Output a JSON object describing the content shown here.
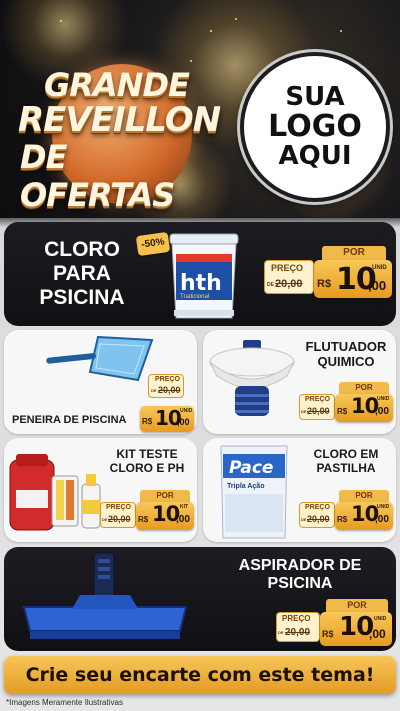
{
  "header": {
    "headline": [
      "GRANDE",
      "REVEILLON",
      "DE OFERTAS"
    ],
    "logo_text": [
      "SUA",
      "LOGO",
      "AQUI"
    ]
  },
  "products": [
    {
      "name": "CLORO\nPARA\nPSICINA",
      "name_lines": [
        "CLORO",
        "PARA",
        "PSICINA"
      ],
      "discount": "-50%",
      "preco_label": "PREÇO",
      "de": "DE",
      "old_price": "20,00",
      "por_label": "POR",
      "currency": "R$",
      "price_int": "10",
      "price_cents": ",00",
      "unit": "UNID"
    },
    {
      "name_lines": [
        "PENEIRA DE PISCINA"
      ],
      "preco_label": "PREÇO",
      "de": "DE",
      "old_price": "20,00",
      "por_label": "POR",
      "currency": "R$",
      "price_int": "10",
      "price_cents": ",00",
      "unit": "UNID"
    },
    {
      "name_lines": [
        "FLUTUADOR",
        "QUIMICO"
      ],
      "preco_label": "PREÇO",
      "de": "DE",
      "old_price": "20,00",
      "por_label": "POR",
      "currency": "R$",
      "price_int": "10",
      "price_cents": ",00",
      "unit": "UNID"
    },
    {
      "name_lines": [
        "KIT TESTE",
        "CLORO E PH"
      ],
      "preco_label": "PREÇO",
      "de": "DE",
      "old_price": "20,00",
      "por_label": "POR",
      "currency": "R$",
      "price_int": "10",
      "price_cents": ",00",
      "unit": "KIT"
    },
    {
      "name_lines": [
        "CLORO EM",
        "PASTILHA"
      ],
      "preco_label": "PREÇO",
      "de": "DE",
      "old_price": "20,00",
      "por_label": "POR",
      "currency": "R$",
      "price_int": "10",
      "price_cents": ",00",
      "unit": "UNID"
    },
    {
      "name_lines": [
        "ASPIRADOR DE",
        "PSICINA"
      ],
      "preco_label": "PREÇO",
      "de": "DE",
      "old_price": "20,00",
      "por_label": "POR",
      "currency": "R$",
      "price_int": "10",
      "price_cents": ",00",
      "unit": "UNID"
    }
  ],
  "packaging": {
    "hth_brand": "hth",
    "hth_sub": "Tradicional",
    "pace_brand": "Pace",
    "pace_sub": "Tripla Ação"
  },
  "cta": "Crie seu encarte com este tema!",
  "disclaimer": "*Imagens Meramente Ilustrativas",
  "colors": {
    "gold": "#f0b94a",
    "dark_panel": "#15151a",
    "light_panel": "#f7f7f7"
  }
}
